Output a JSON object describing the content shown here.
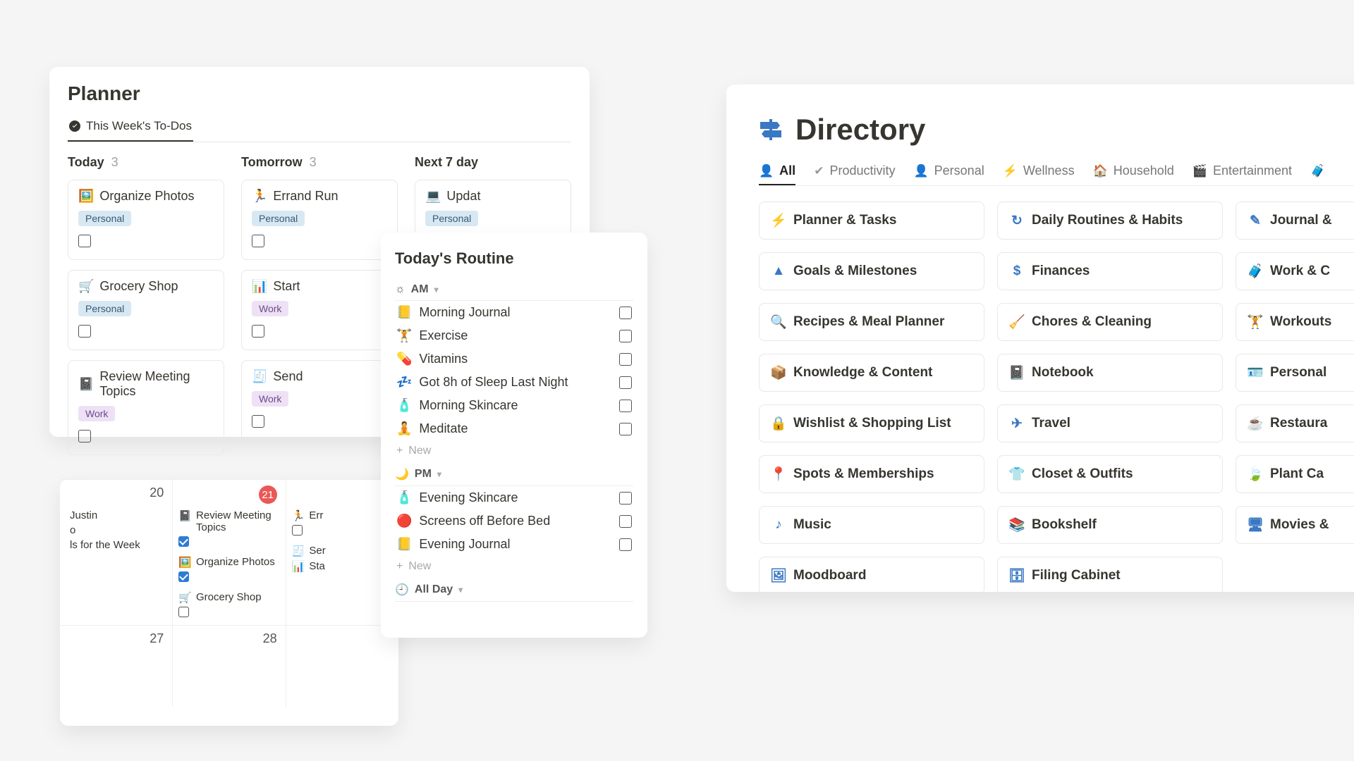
{
  "planner": {
    "title": "Planner",
    "tab_label": "This Week's To-Dos",
    "columns": [
      {
        "title": "Today",
        "count": "3",
        "tasks": [
          {
            "emoji": "🖼️",
            "title": "Organize Photos",
            "tag": "Personal"
          },
          {
            "emoji": "🛒",
            "title": "Grocery Shop",
            "tag": "Personal"
          },
          {
            "emoji": "📓",
            "title": "Review Meeting Topics",
            "tag": "Work"
          }
        ]
      },
      {
        "title": "Tomorrow",
        "count": "3",
        "tasks": [
          {
            "emoji": "🏃",
            "title": "Errand Run",
            "tag": "Personal"
          },
          {
            "emoji": "📊",
            "title": "Start",
            "tag": "Work"
          },
          {
            "emoji": "🧾",
            "title": "Send",
            "tag": "Work"
          }
        ]
      },
      {
        "title": "Next 7 day",
        "count": "",
        "tasks": [
          {
            "emoji": "💻",
            "title": "Updat",
            "tag": "Personal"
          }
        ]
      }
    ]
  },
  "calendar": {
    "rows": [
      {
        "cells": [
          {
            "day": "20",
            "entries": [
              {
                "emoji": "",
                "label": "Justin",
                "checked": false,
                "showcb": false
              },
              {
                "emoji": "",
                "label": "o",
                "checked": false,
                "showcb": false
              },
              {
                "emoji": "",
                "label": "ls for the Week",
                "checked": false,
                "showcb": false
              }
            ]
          },
          {
            "day": "21",
            "badge": true,
            "entries": [
              {
                "emoji": "📓",
                "label": "Review Meeting Topics",
                "checked": true,
                "showcb": true
              },
              {
                "emoji": "🖼️",
                "label": "Organize Photos",
                "checked": true,
                "showcb": true
              },
              {
                "emoji": "🛒",
                "label": "Grocery Shop",
                "checked": false,
                "showcb": true
              }
            ]
          },
          {
            "day": "",
            "entries": [
              {
                "emoji": "🏃",
                "label": "Err",
                "checked": false,
                "showcb": true
              },
              {
                "emoji": "🧾",
                "label": "Ser",
                "checked": false,
                "showcb": false
              },
              {
                "emoji": "📊",
                "label": "Sta",
                "checked": false,
                "showcb": false
              }
            ]
          }
        ]
      },
      {
        "cells": [
          {
            "day": "27",
            "entries": []
          },
          {
            "day": "28",
            "entries": []
          },
          {
            "day": "",
            "entries": []
          }
        ]
      }
    ]
  },
  "routine": {
    "title": "Today's Routine",
    "groups": [
      {
        "icon": "☼",
        "label": "AM",
        "items": [
          {
            "emoji": "📒",
            "label": "Morning Journal"
          },
          {
            "emoji": "🏋️",
            "label": "Exercise"
          },
          {
            "emoji": "💊",
            "label": "Vitamins"
          },
          {
            "emoji": "💤",
            "label": "Got 8h of Sleep Last Night"
          },
          {
            "emoji": "🧴",
            "label": "Morning Skincare"
          },
          {
            "emoji": "🧘",
            "label": "Meditate"
          }
        ],
        "add": "New"
      },
      {
        "icon": "🌙",
        "label": "PM",
        "items": [
          {
            "emoji": "🧴",
            "label": "Evening Skincare"
          },
          {
            "emoji": "🔴",
            "label": "Screens off Before Bed"
          },
          {
            "emoji": "📒",
            "label": "Evening Journal"
          }
        ],
        "add": "New"
      },
      {
        "icon": "🕘",
        "label": "All Day",
        "items": [],
        "add": null
      }
    ]
  },
  "directory": {
    "title": "Directory",
    "tabs": [
      {
        "icon": "👤",
        "label": "All",
        "active": true
      },
      {
        "icon": "✔",
        "label": "Productivity"
      },
      {
        "icon": "👤",
        "label": "Personal"
      },
      {
        "icon": "⚡",
        "label": "Wellness"
      },
      {
        "icon": "🏠",
        "label": "Household"
      },
      {
        "icon": "🎬",
        "label": "Entertainment"
      }
    ],
    "items": [
      {
        "icon": "⚡",
        "label": "Planner & Tasks"
      },
      {
        "icon": "↻",
        "label": "Daily Routines & Habits"
      },
      {
        "icon": "✎",
        "label": "Journal &"
      },
      {
        "icon": "▲",
        "label": "Goals & Milestones"
      },
      {
        "icon": "$",
        "label": "Finances"
      },
      {
        "icon": "🧳",
        "label": "Work & C"
      },
      {
        "icon": "🔍",
        "label": "Recipes & Meal Planner"
      },
      {
        "icon": "🧹",
        "label": "Chores & Cleaning"
      },
      {
        "icon": "🏋",
        "label": "Workouts"
      },
      {
        "icon": "📦",
        "label": "Knowledge & Content"
      },
      {
        "icon": "📓",
        "label": "Notebook"
      },
      {
        "icon": "🪪",
        "label": "Personal"
      },
      {
        "icon": "🔒",
        "label": "Wishlist & Shopping List"
      },
      {
        "icon": "✈",
        "label": "Travel"
      },
      {
        "icon": "☕",
        "label": "Restaura"
      },
      {
        "icon": "📍",
        "label": "Spots & Memberships"
      },
      {
        "icon": "👕",
        "label": "Closet & Outfits"
      },
      {
        "icon": "🍃",
        "label": "Plant Ca"
      },
      {
        "icon": "♪",
        "label": "Music"
      },
      {
        "icon": "📚",
        "label": "Bookshelf"
      },
      {
        "icon": "🖥",
        "label": "Movies &"
      },
      {
        "icon": "🖼",
        "label": "Moodboard"
      },
      {
        "icon": "🗄",
        "label": "Filing Cabinet"
      }
    ]
  }
}
